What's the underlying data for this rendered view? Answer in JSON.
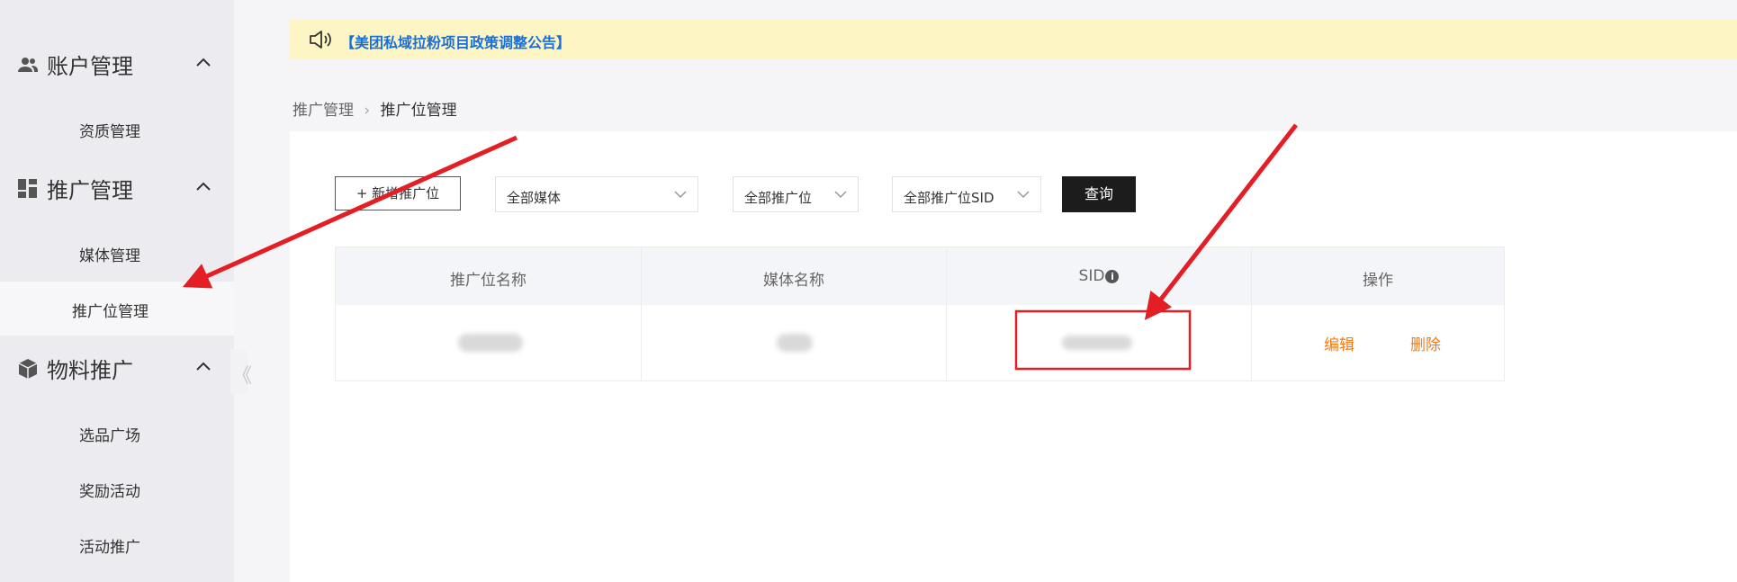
{
  "sidebar": {
    "groups": [
      {
        "title": "账户管理",
        "icon": "users-icon",
        "items": [
          "资质管理"
        ]
      },
      {
        "title": "推广管理",
        "icon": "dashboard-grid-icon",
        "items": [
          "媒体管理",
          "推广位管理"
        ]
      },
      {
        "title": "物料推广",
        "icon": "cube-icon",
        "items": [
          "选品广场",
          "奖励活动",
          "活动推广"
        ]
      }
    ],
    "active_item": "推广位管理",
    "collapse_glyph": "《"
  },
  "notice": {
    "icon": "speaker-icon",
    "text": "【美团私域拉粉项目政策调整公告】"
  },
  "breadcrumb": {
    "parent": "推广管理",
    "separator": "›",
    "current": "推广位管理"
  },
  "toolbar": {
    "add_label": "+ 新增推广位",
    "filters": [
      {
        "selected": "全部媒体"
      },
      {
        "selected": "全部推广位"
      },
      {
        "selected": "全部推广位SID"
      }
    ],
    "query_label": "查询"
  },
  "table": {
    "columns": [
      "推广位名称",
      "媒体名称",
      "SID",
      "操作"
    ],
    "actions": {
      "edit": "编辑",
      "delete": "删除"
    }
  },
  "colors": {
    "annotation": "#e31e24",
    "action": "#f07c1a",
    "notice_text": "#1a6fd9",
    "notice_bg": "#fdf5c4"
  }
}
